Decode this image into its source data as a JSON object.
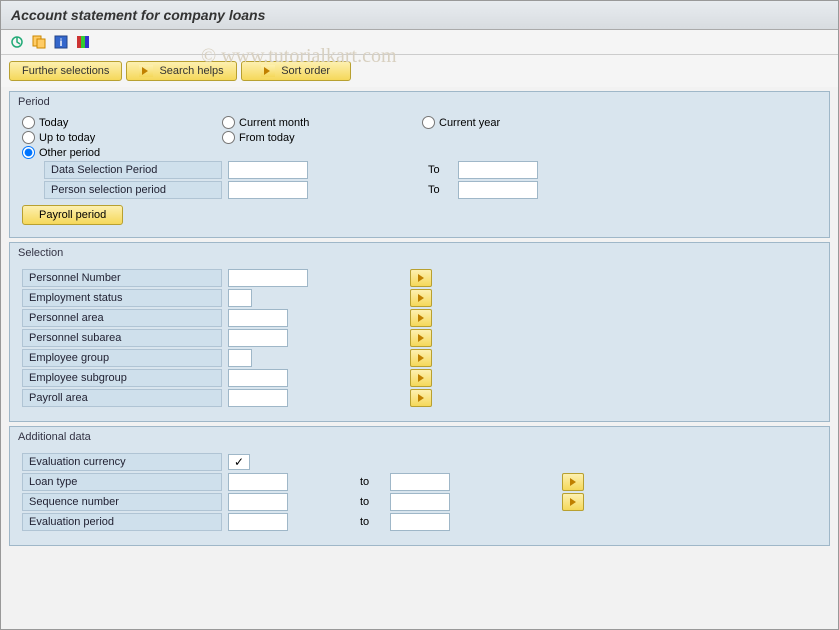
{
  "title": "Account statement for company loans",
  "watermark": "© www.tutorialkart.com",
  "buttons": {
    "further": "Further selections",
    "search": "Search helps",
    "sort": "Sort order"
  },
  "period": {
    "title": "Period",
    "today": "Today",
    "current_month": "Current month",
    "current_year": "Current year",
    "up_to_today": "Up to today",
    "from_today": "From today",
    "other_period": "Other period",
    "data_sel": "Data Selection Period",
    "person_sel": "Person selection period",
    "to": "To",
    "payroll": "Payroll period"
  },
  "selection": {
    "title": "Selection",
    "personnel_number": "Personnel Number",
    "employment_status": "Employment status",
    "personnel_area": "Personnel area",
    "personnel_subarea": "Personnel subarea",
    "employee_group": "Employee group",
    "employee_subgroup": "Employee subgroup",
    "payroll_area": "Payroll area"
  },
  "additional": {
    "title": "Additional data",
    "eval_currency": "Evaluation currency",
    "loan_type": "Loan type",
    "sequence_number": "Sequence number",
    "eval_period": "Evaluation period",
    "to": "to"
  }
}
